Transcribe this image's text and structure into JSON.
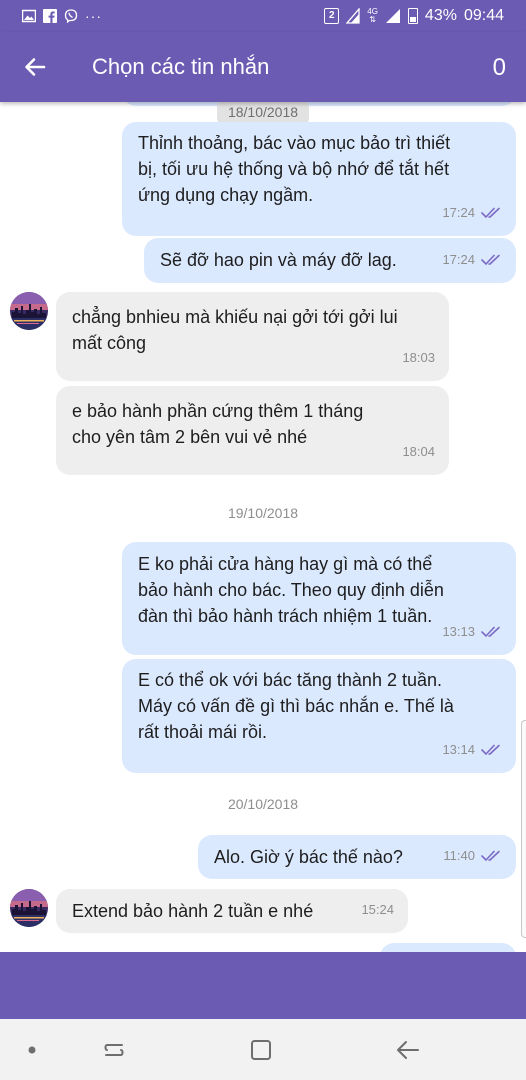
{
  "status_bar": {
    "sim_slot": "2",
    "network": "4G",
    "battery": "43%",
    "time": "09:44"
  },
  "header": {
    "title": "Chọn các tin nhắn",
    "selected_count": "0"
  },
  "date_separators": [
    "18/10/2018",
    "19/10/2018",
    "20/10/2018"
  ],
  "messages": [
    {
      "direction": "out",
      "text": [
        "Thỉnh thoảng, bác vào mục bảo trì thiết",
        "bị, tối ưu hệ thống và bộ nhớ để tắt hết",
        "ứng dụng chạy ngầm."
      ],
      "time": "17:24"
    },
    {
      "direction": "out",
      "text": [
        "Sẽ đỡ hao pin và máy đỡ lag."
      ],
      "time": "17:24"
    },
    {
      "direction": "in",
      "text": [
        "chẳng bnhieu mà khiếu nại gởi tới gởi lui",
        "mất công"
      ],
      "time": "18:03"
    },
    {
      "direction": "in",
      "text": [
        "e bảo hành phần cứng thêm 1 tháng",
        "cho yên tâm 2 bên vui vẻ nhé"
      ],
      "time": "18:04"
    },
    {
      "direction": "out",
      "text": [
        "E ko phải cửa hàng hay gì mà có thể",
        "bảo hành cho bác. Theo quy định diễn",
        "đàn thì bảo hành trách nhiệm 1 tuần."
      ],
      "time": "13:13"
    },
    {
      "direction": "out",
      "text": [
        "E có thể ok với bác tăng thành 2 tuần.",
        "Máy có vấn đề gì thì bác nhắn e. Thế là",
        "rất thoải mái rồi."
      ],
      "time": "13:14"
    },
    {
      "direction": "out",
      "text": [
        "Alo. Giờ ý bác thế nào?"
      ],
      "time": "11:40"
    },
    {
      "direction": "in",
      "text": [
        "Extend bảo hành 2 tuần e nhé"
      ],
      "time": "15:24"
    }
  ],
  "colors": {
    "bar": "#6c5bb3",
    "outgoing_bubble": "#dbe9ff",
    "incoming_bubble": "#eeeeee",
    "read_ticks": "#7c6bc4"
  }
}
